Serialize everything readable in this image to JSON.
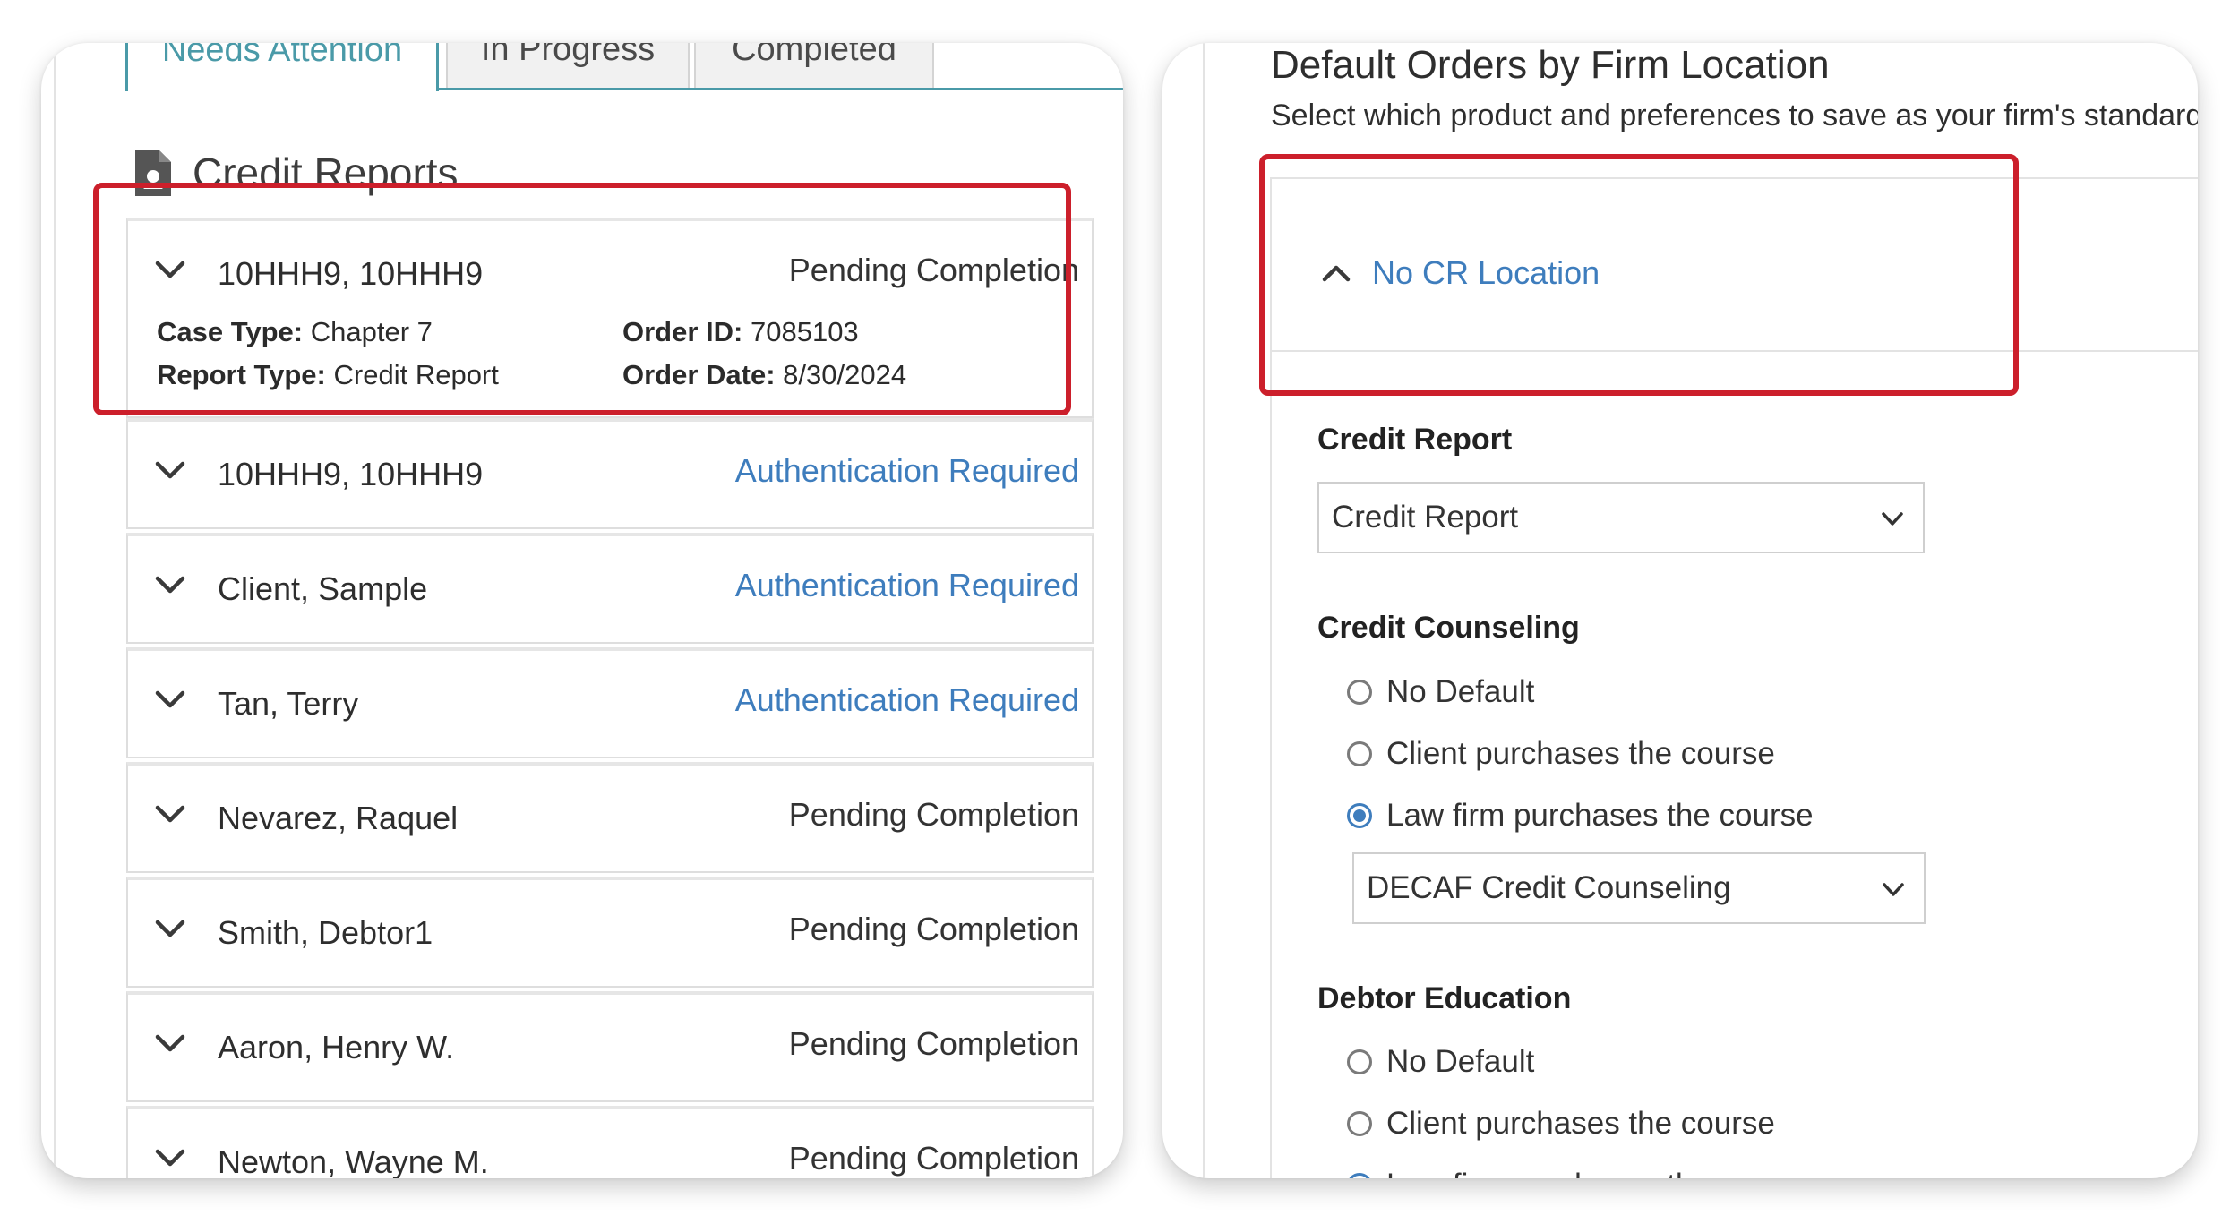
{
  "left": {
    "tabs": [
      "Needs Attention",
      "In Progress",
      "Completed"
    ],
    "section_title": "Credit Reports",
    "expanded": {
      "name": "10HHH9, 10HHH9",
      "status": "Pending Completion",
      "case_type_label": "Case Type:",
      "case_type": "Chapter 7",
      "report_type_label": "Report Type:",
      "report_type": "Credit Report",
      "order_id_label": "Order ID:",
      "order_id": "7085103",
      "order_date_label": "Order Date:",
      "order_date": "8/30/2024"
    },
    "rows": [
      {
        "name": "10HHH9, 10HHH9",
        "status": "Authentication Required"
      },
      {
        "name": "Client, Sample",
        "status": "Authentication Required"
      },
      {
        "name": "Tan, Terry",
        "status": "Authentication Required"
      },
      {
        "name": "Nevarez, Raquel",
        "status": "Pending Completion"
      },
      {
        "name": "Smith, Debtor1",
        "status": "Pending Completion"
      },
      {
        "name": "Aaron, Henry W.",
        "status": "Pending Completion"
      },
      {
        "name": "Newton, Wayne M.",
        "status": "Pending Completion"
      }
    ]
  },
  "right": {
    "title": "Default Orders by Firm Location",
    "subtitle": "Select which product and preferences to save as your firm's standard",
    "location": "No CR Location",
    "credit_report": {
      "label": "Credit Report",
      "selected": "Credit Report"
    },
    "credit_counseling": {
      "label": "Credit Counseling",
      "options": [
        "No Default",
        "Client purchases the course",
        "Law firm purchases the course"
      ],
      "selected_index": 2,
      "provider": "DECAF Credit Counseling"
    },
    "debtor_education": {
      "label": "Debtor Education",
      "options": [
        "No Default",
        "Client purchases the course",
        "Law firm purchases the course"
      ]
    }
  },
  "colors": {
    "accent_blue": "#3e7dbd",
    "tab_teal": "#4a9aa8",
    "highlight_red": "#cc1f2b"
  }
}
